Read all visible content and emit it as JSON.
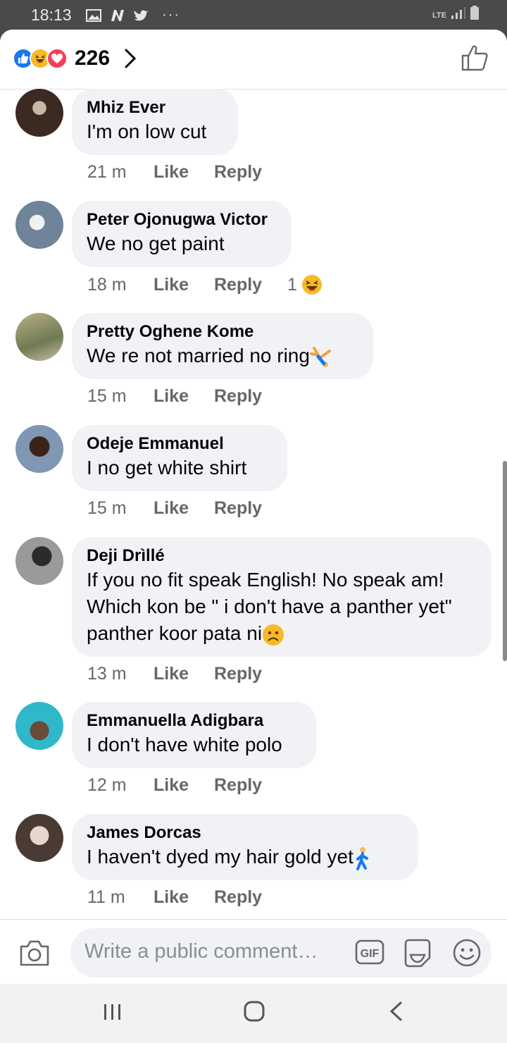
{
  "status_bar": {
    "time": "18:13",
    "network": "LTE",
    "overflow": "···"
  },
  "header": {
    "reaction_icons": [
      "like-reaction-icon",
      "haha-reaction-icon",
      "love-reaction-icon"
    ],
    "reaction_count": "226"
  },
  "comments": [
    {
      "name": "Mhiz Ever",
      "text": [
        "I'm on low cut"
      ],
      "time": "21 m",
      "like": "Like",
      "reply": "Reply"
    },
    {
      "name": "Peter Ojonugwa Victor",
      "text": [
        "We no get paint"
      ],
      "time": "18 m",
      "like": "Like",
      "reply": "Reply",
      "reaction_count": "1",
      "reaction_icon": "haha-emoji-icon"
    },
    {
      "name": "Pretty Oghene Kome",
      "text": [
        "We re not married no ring"
      ],
      "time": "15 m",
      "like": "Like",
      "reply": "Reply",
      "emoji": "cartwheel-emoji-icon"
    },
    {
      "name": "Odeje Emmanuel",
      "text": [
        "I no get white shirt"
      ],
      "time": "15 m",
      "like": "Like",
      "reply": "Reply"
    },
    {
      "name": "Deji Drìllé",
      "text": [
        "If you no fit speak English! No speak am!",
        "Which kon be \" i don't have a panther yet\"",
        "panther koor pata ni"
      ],
      "time": "13 m",
      "like": "Like",
      "reply": "Reply",
      "emoji": "frowning-emoji-icon"
    },
    {
      "name": "Emmanuella Adigbara",
      "text": [
        "I don't have white polo"
      ],
      "time": "12 m",
      "like": "Like",
      "reply": "Reply"
    },
    {
      "name": "James Dorcas",
      "text": [
        "I haven't dyed my hair gold yet"
      ],
      "time": "11 m",
      "like": "Like",
      "reply": "Reply",
      "emoji": "walking-person-emoji-icon"
    }
  ],
  "composer": {
    "placeholder": "Write a public comment…",
    "gif_label": "GIF"
  },
  "colors": {
    "accent": "#1877f2",
    "bubble": "#f0f2f5",
    "meta": "#65676b"
  }
}
